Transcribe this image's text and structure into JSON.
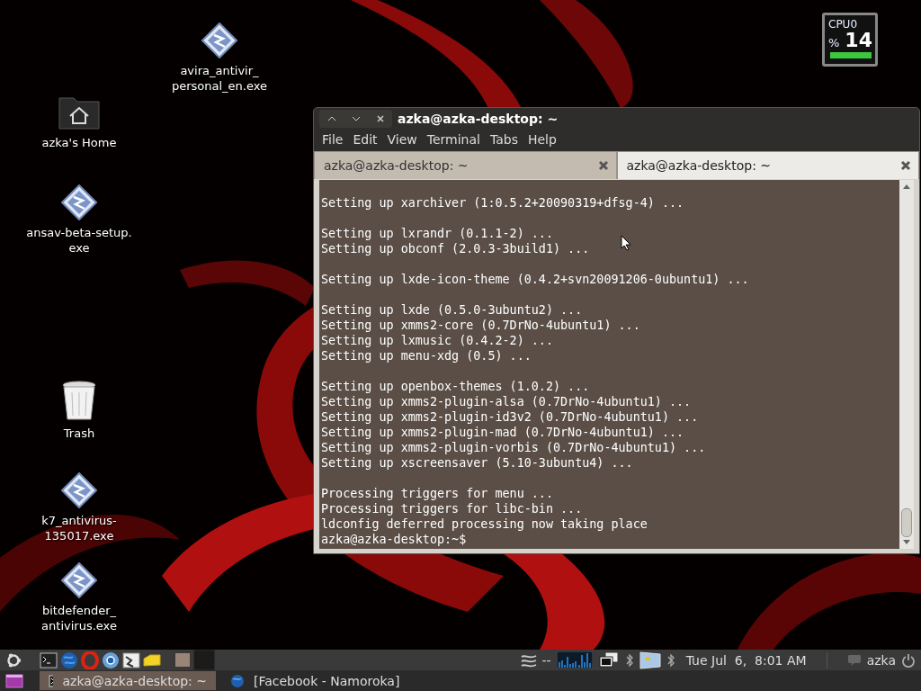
{
  "desktop_icons": [
    {
      "label": "avira_antivir_\npersonal_en.exe",
      "kind": "exe"
    },
    {
      "label": "azka's Home",
      "kind": "home"
    },
    {
      "label": "ansav-beta-setup.\nexe",
      "kind": "exe"
    },
    {
      "label": "Trash",
      "kind": "trash"
    },
    {
      "label": "k7_antivirus-\n135017.exe",
      "kind": "exe"
    },
    {
      "label": "bitdefender_\nantivirus.exe",
      "kind": "exe"
    }
  ],
  "cpu_widget": {
    "label": "CPU0",
    "unit": "%",
    "value": "14"
  },
  "terminal": {
    "title": "azka@azka-desktop: ~",
    "menu": [
      "File",
      "Edit",
      "View",
      "Terminal",
      "Tabs",
      "Help"
    ],
    "tabs": [
      {
        "label": "azka@azka-desktop: ~",
        "selected": false
      },
      {
        "label": "azka@azka-desktop: ~",
        "selected": true
      }
    ],
    "output_blocks": [
      [
        "Setting up xarchiver (1:0.5.2+20090319+dfsg-4) ..."
      ],
      [
        "Setting up lxrandr (0.1.1-2) ...",
        "Setting up obconf (2.0.3-3build1) ..."
      ],
      [
        "Setting up lxde-icon-theme (0.4.2+svn20091206-0ubuntu1) ..."
      ],
      [
        "Setting up lxde (0.5.0-3ubuntu2) ...",
        "Setting up xmms2-core (0.7DrNo-4ubuntu1) ...",
        "Setting up lxmusic (0.4.2-2) ...",
        "Setting up menu-xdg (0.5) ..."
      ],
      [
        "Setting up openbox-themes (1.0.2) ...",
        "Setting up xmms2-plugin-alsa (0.7DrNo-4ubuntu1) ...",
        "Setting up xmms2-plugin-id3v2 (0.7DrNo-4ubuntu1) ...",
        "Setting up xmms2-plugin-mad (0.7DrNo-4ubuntu1) ...",
        "Setting up xmms2-plugin-vorbis (0.7DrNo-4ubuntu1) ...",
        "Setting up xscreensaver (5.10-3ubuntu4) ..."
      ],
      [
        "Processing triggers for menu ...",
        "Processing triggers for libc-bin ...",
        "ldconfig deferred processing now taking place"
      ]
    ],
    "prompt": "azka@azka-desktop:~$"
  },
  "top_panel": {
    "workspaces": [
      {
        "selected": true
      },
      {
        "selected": false
      }
    ],
    "network_status": "--",
    "clock": "Tue Jul  6,  8:01 AM",
    "user": "azka"
  },
  "bottom_panel": {
    "tasks": [
      {
        "title": "azka@azka-desktop: ~",
        "kind": "terminal",
        "selected": true
      },
      {
        "title": "[Facebook - Namoroka]",
        "kind": "browser",
        "selected": false
      }
    ]
  }
}
